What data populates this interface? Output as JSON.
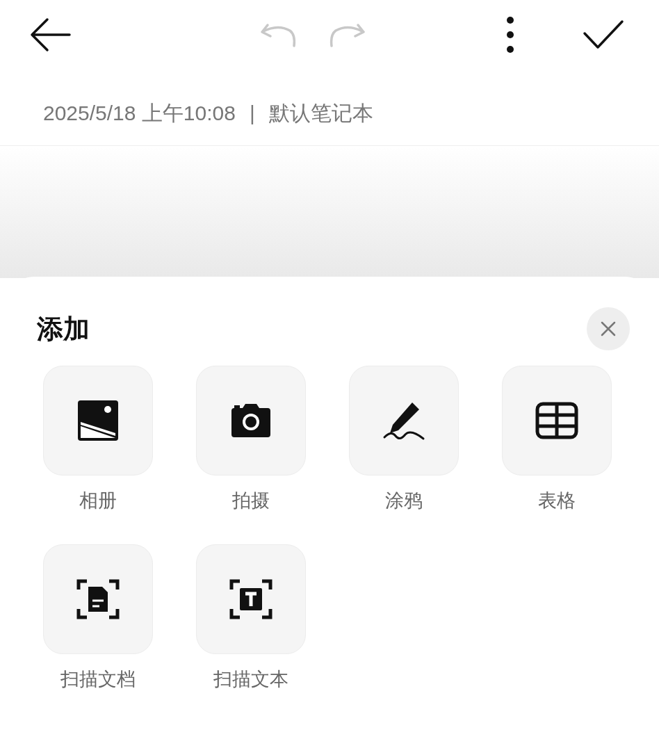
{
  "toolbar": {
    "undo": {
      "disabled": true
    },
    "redo": {
      "disabled": true
    }
  },
  "note_meta": {
    "datetime": "2025/5/18 上午10:08",
    "separator": "|",
    "notebook": "默认笔记本"
  },
  "sheet": {
    "title": "添加",
    "items": [
      {
        "kind": "album",
        "label": "相册"
      },
      {
        "kind": "camera",
        "label": "拍摄"
      },
      {
        "kind": "doodle",
        "label": "涂鸦"
      },
      {
        "kind": "table",
        "label": "表格"
      },
      {
        "kind": "scan_doc",
        "label": "扫描文档"
      },
      {
        "kind": "scan_text",
        "label": "扫描文本"
      }
    ]
  }
}
